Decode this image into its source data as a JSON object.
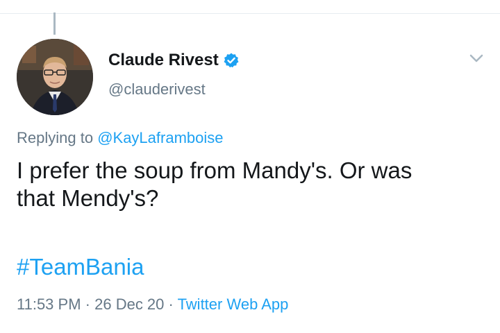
{
  "tweet": {
    "display_name": "Claude Rivest",
    "handle": "@clauderivest",
    "verified": true,
    "replying_prefix": "Replying to ",
    "replying_to": "@KayLaframboise",
    "text": "I prefer the soup from Mandy's. Or was\nthat Mendy's?",
    "hashtag": "#TeamBania",
    "time": "11:53 PM",
    "separator": " · ",
    "date": "26 Dec 20",
    "source": "Twitter Web App"
  },
  "icons": {
    "verified": "verified-badge-icon",
    "menu": "chevron-down-icon"
  },
  "colors": {
    "accent": "#1da1f2",
    "secondary_text": "#657786",
    "primary_text": "#14171a"
  }
}
